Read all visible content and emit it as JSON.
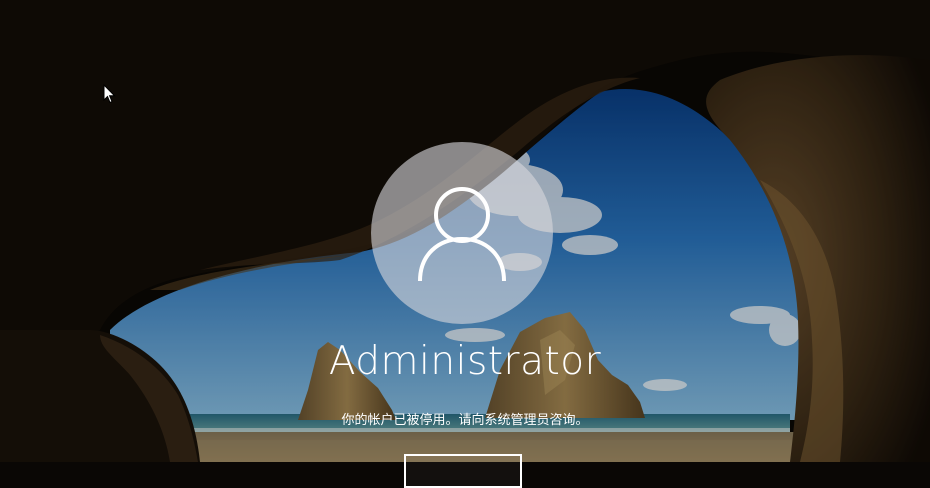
{
  "lock_screen": {
    "username": "Administrator",
    "message": "你的帐户已被停用。请向系统管理员咨询。",
    "confirm_button_label": ""
  },
  "icons": {
    "user_avatar": "user-silhouette-icon",
    "cursor": "mouse-pointer-icon"
  },
  "colors": {
    "avatar_circle": "#d7d7dc",
    "text": "#ffffff",
    "sky_top": "#0d4f9c",
    "sky_bottom": "#5aa7dc",
    "sea": "#2f7f8f",
    "cave_rock": "#3a2a18"
  }
}
